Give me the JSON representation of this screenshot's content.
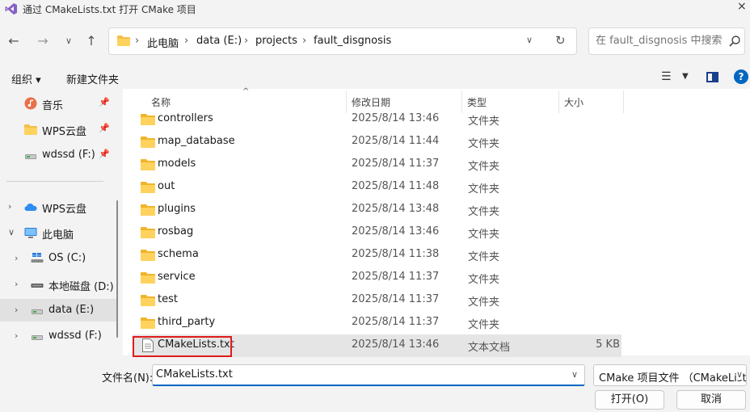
{
  "window": {
    "title": "通过 CMakeLists.txt 打开 CMake 项目",
    "close_glyph": "×"
  },
  "nav": {
    "back": "←",
    "forward": "→",
    "recent": "∨",
    "up": "↑"
  },
  "address": {
    "crumbs": [
      "此电脑",
      "data (E:)",
      "projects",
      "fault_disgnosis"
    ],
    "separator": "›"
  },
  "search": {
    "placeholder": "在 fault_disgnosis 中搜索"
  },
  "toolbar": {
    "organize": "组织 ▾",
    "new_folder": "新建文件夹",
    "view_glyph": "☰"
  },
  "sidebar": {
    "quick": [
      {
        "label": "音乐",
        "icon": "music-icon"
      },
      {
        "label": "WPS云盘",
        "icon": "folder-icon"
      },
      {
        "label": "wdssd (F:)",
        "icon": "drive-icon"
      }
    ],
    "tree": [
      {
        "label": "WPS云盘",
        "icon": "cloud-icon",
        "chevron": "›"
      },
      {
        "label": "此电脑",
        "icon": "pc-icon",
        "chevron": "∨"
      },
      {
        "label": "OS (C:)",
        "icon": "os-drive-icon",
        "chevron": "›"
      },
      {
        "label": "本地磁盘 (D:)",
        "icon": "disk-drive-icon",
        "chevron": "›"
      },
      {
        "label": "data (E:)",
        "icon": "drive-icon",
        "chevron": "›",
        "selected": true
      },
      {
        "label": "wdssd (F:)",
        "icon": "drive-icon",
        "chevron": "›"
      }
    ]
  },
  "columns": {
    "name": "名称",
    "date": "修改日期",
    "type": "类型",
    "size": "大小"
  },
  "files": [
    {
      "name": "controllers",
      "date": "2025/8/14 13:46",
      "type": "文件夹",
      "size": "",
      "kind": "folder"
    },
    {
      "name": "map_database",
      "date": "2025/8/14 11:44",
      "type": "文件夹",
      "size": "",
      "kind": "folder"
    },
    {
      "name": "models",
      "date": "2025/8/14 11:37",
      "type": "文件夹",
      "size": "",
      "kind": "folder"
    },
    {
      "name": "out",
      "date": "2025/8/14 11:48",
      "type": "文件夹",
      "size": "",
      "kind": "folder"
    },
    {
      "name": "plugins",
      "date": "2025/8/14 13:48",
      "type": "文件夹",
      "size": "",
      "kind": "folder"
    },
    {
      "name": "rosbag",
      "date": "2025/8/14 13:46",
      "type": "文件夹",
      "size": "",
      "kind": "folder"
    },
    {
      "name": "schema",
      "date": "2025/8/14 11:38",
      "type": "文件夹",
      "size": "",
      "kind": "folder"
    },
    {
      "name": "service",
      "date": "2025/8/14 11:37",
      "type": "文件夹",
      "size": "",
      "kind": "folder"
    },
    {
      "name": "test",
      "date": "2025/8/14 11:37",
      "type": "文件夹",
      "size": "",
      "kind": "folder"
    },
    {
      "name": "third_party",
      "date": "2025/8/14 11:37",
      "type": "文件夹",
      "size": "",
      "kind": "folder"
    },
    {
      "name": "CMakeLists.txt",
      "date": "2025/8/14 13:46",
      "type": "文本文档",
      "size": "5 KB",
      "kind": "file",
      "selected": true
    }
  ],
  "bottom": {
    "filename_label": "文件名(N):",
    "filename_value": "CMakeLists.txt",
    "filetype": "CMake 项目文件 （CMakeLists.txt）",
    "open": "打开(O)",
    "cancel": "取消"
  },
  "colors": {
    "accent": "#0067c0",
    "folder": "#f4c04a",
    "highlight": "#e01b1b"
  }
}
